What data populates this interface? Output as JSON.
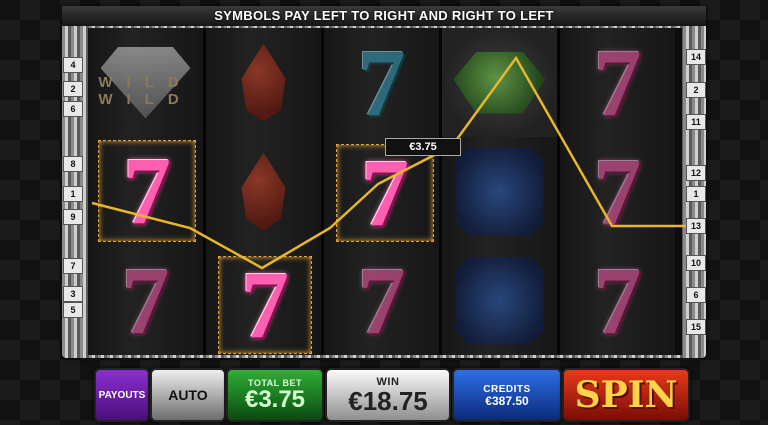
{
  "banner": "SYMBOLS PAY LEFT TO RIGHT AND RIGHT TO LEFT",
  "win_tag": "€3.75",
  "wild_label": "WILD WILD",
  "left_lines": [
    "4",
    "2",
    "6",
    "8",
    "1",
    "9",
    "7",
    "3",
    "5"
  ],
  "right_lines": [
    "14",
    "2",
    "11",
    "12",
    "1",
    "13",
    "10",
    "6",
    "15"
  ],
  "buttons": {
    "payouts": "PAYOUTS",
    "auto": "AUTO",
    "total_bet_label": "TOTAL BET",
    "total_bet_value": "€3.75",
    "win_label": "WIN",
    "win_value": "€18.75",
    "credits_label": "CREDITS",
    "credits_value": "€387.50",
    "spin": "SPIN"
  },
  "symbols": {
    "seven": "7"
  }
}
